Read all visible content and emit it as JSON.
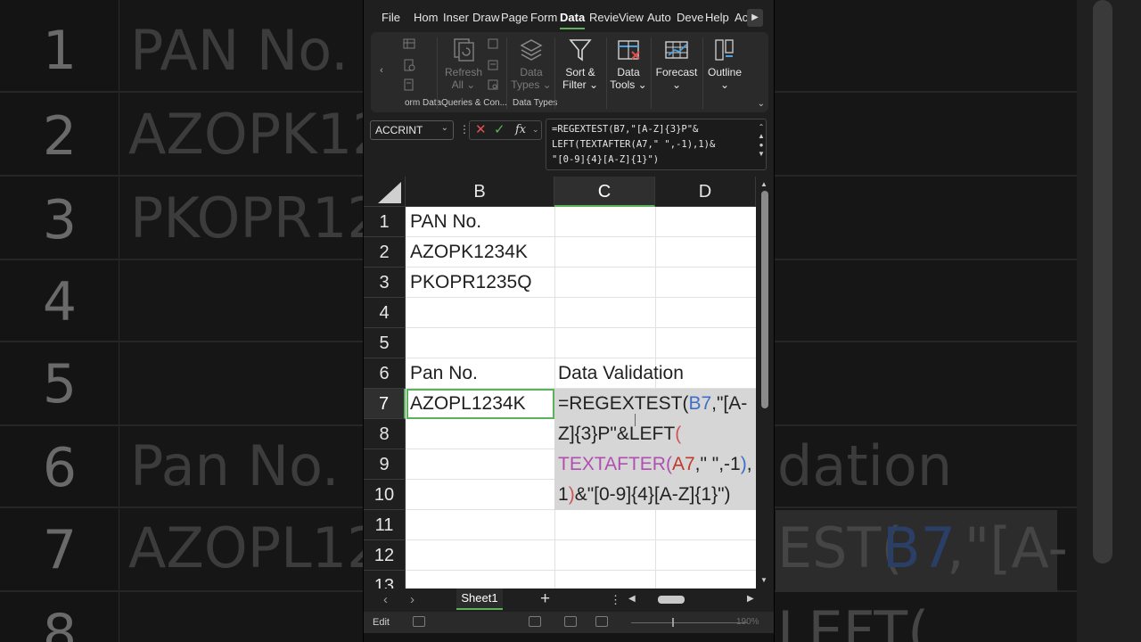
{
  "menu": {
    "items": [
      "File",
      "Hom",
      "Inser",
      "Draw",
      "Page",
      "Form",
      "Data",
      "Revie",
      "View",
      "Auto",
      "Deve",
      "Help",
      "Ac"
    ],
    "active": "Data"
  },
  "ribbon": {
    "group_labels": [
      "orm Data",
      "Queries & Con...",
      "Data Types"
    ],
    "refresh_all": [
      "Refresh",
      "All ⌄"
    ],
    "data_types": [
      "Data",
      "Types ⌄"
    ],
    "sort_filter": [
      "Sort &",
      "Filter ⌄"
    ],
    "data_tools": [
      "Data",
      "Tools ⌄"
    ],
    "forecast": [
      "Forecast",
      "⌄"
    ],
    "outline": [
      "Outline",
      "⌄"
    ]
  },
  "formula_bar": {
    "name_box": "ACCRINT",
    "formula_lines": [
      "=REGEXTEST(B7,\"[A-Z]{3}P\"&",
      "LEFT(TEXTAFTER(A7,\" \",-1),1)&",
      "\"[0-9]{4}[A-Z]{1}\")"
    ]
  },
  "grid": {
    "columns": [
      "B",
      "C",
      "D"
    ],
    "selected_column": "C",
    "rows": [
      "1",
      "2",
      "3",
      "4",
      "5",
      "6",
      "7",
      "8",
      "9",
      "10",
      "11",
      "12",
      "13"
    ],
    "selected_row": "7",
    "cells": {
      "b1": "PAN No.",
      "b2": "AZOPK1234K",
      "b3": "PKOPR1235Q",
      "b6": "Pan No.",
      "c6": "Data Validation",
      "b7": "AZOPL1234K"
    },
    "edit": {
      "line1": {
        "a": "=REGEXTEST(",
        "b": "B7",
        "c": ",\"[A-"
      },
      "line2": {
        "a": "Z]{3}P\"&LEFT",
        "b": "("
      },
      "line3": {
        "a": "TEXTAFTER",
        "b": "(",
        "c": "A7",
        "d": ",\" \",-1",
        "e": ")",
        "f": ","
      },
      "line4": {
        "a": "1",
        "b": ")",
        "c": "&\"[0-9]{4}[A-Z]{1}\")"
      }
    }
  },
  "sheets": {
    "tabs": [
      "Sheet1"
    ]
  },
  "status": {
    "mode": "Edit",
    "zoom": "190%"
  },
  "background": {
    "row_numbers": [
      "1",
      "2",
      "3",
      "4",
      "5",
      "6",
      "7",
      "8"
    ],
    "texts": [
      "PAN No.",
      "AZOPK12",
      "PKOPR12",
      "Pan No.",
      "AZOPL12",
      "dation",
      "EST(",
      "B7",
      ",\"[A-",
      "LEFT("
    ]
  }
}
